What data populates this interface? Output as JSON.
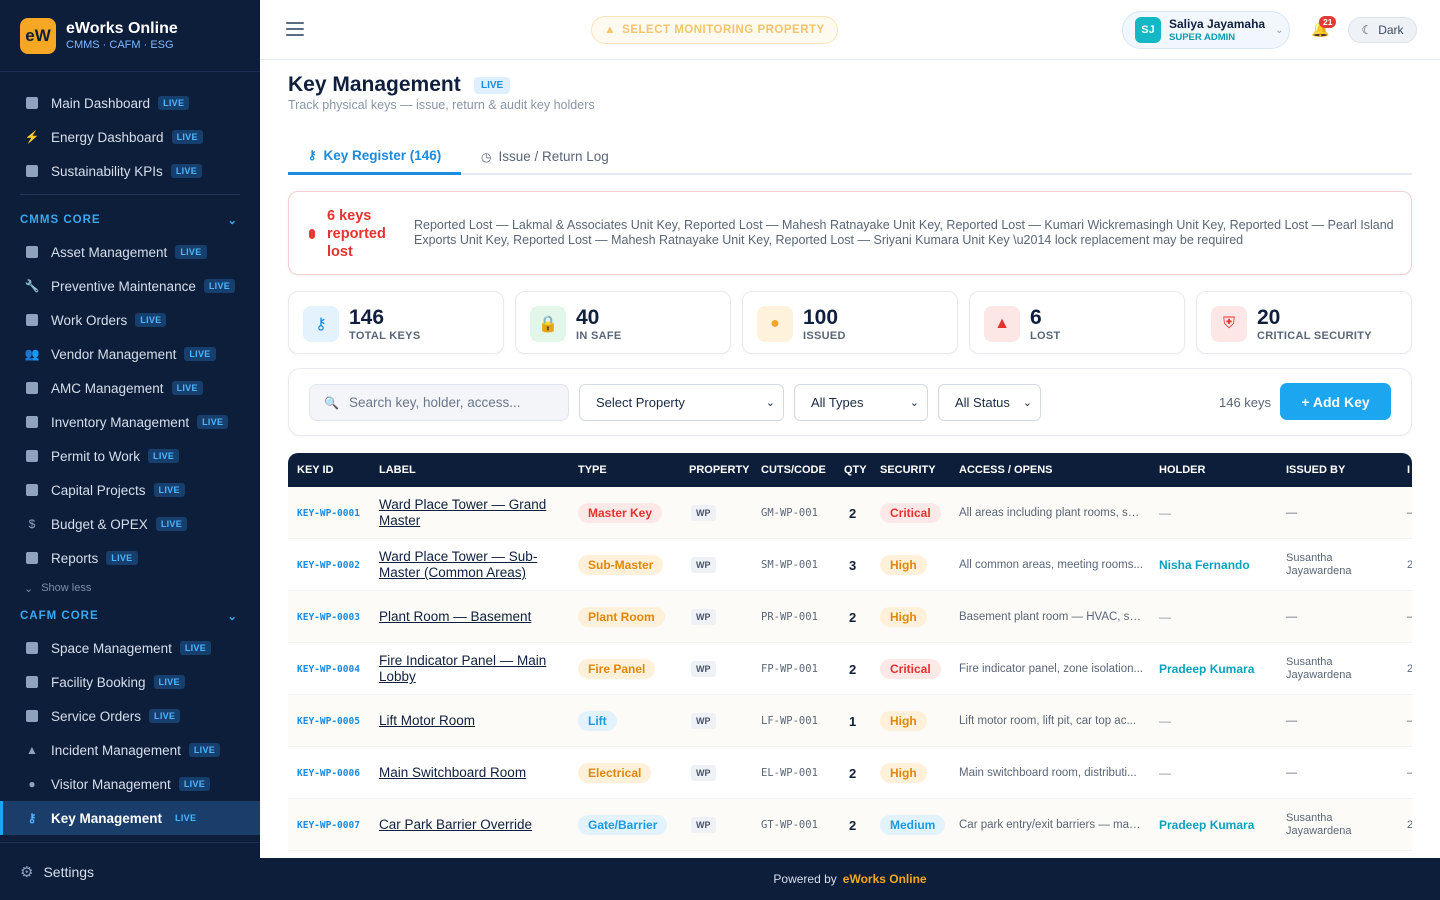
{
  "brand": {
    "logo": "eW",
    "name": "eWorks Online",
    "sub": "CMMS · CAFM · ESG"
  },
  "sidebar": {
    "top": [
      {
        "label": "Main Dashboard",
        "badge": "LIVE",
        "icon": "dashboard-icon"
      },
      {
        "label": "Energy Dashboard",
        "badge": "LIVE",
        "icon": "bolt-icon"
      },
      {
        "label": "Sustainability KPIs",
        "badge": "LIVE",
        "icon": "leaf-icon"
      }
    ],
    "cmms_title": "CMMS CORE",
    "cmms": [
      {
        "label": "Asset Management",
        "badge": "LIVE"
      },
      {
        "label": "Preventive Maintenance",
        "badge": "LIVE"
      },
      {
        "label": "Work Orders",
        "badge": "LIVE"
      },
      {
        "label": "Vendor Management",
        "badge": "LIVE"
      },
      {
        "label": "AMC Management",
        "badge": "LIVE"
      },
      {
        "label": "Inventory Management",
        "badge": "LIVE"
      },
      {
        "label": "Permit to Work",
        "badge": "LIVE"
      },
      {
        "label": "Capital Projects",
        "badge": "LIVE"
      },
      {
        "label": "Budget & OPEX",
        "badge": "LIVE"
      },
      {
        "label": "Reports",
        "badge": "LIVE"
      }
    ],
    "show_less": "Show less",
    "cafm_title": "CAFM CORE",
    "cafm": [
      {
        "label": "Space Management",
        "badge": "LIVE"
      },
      {
        "label": "Facility Booking",
        "badge": "LIVE"
      },
      {
        "label": "Service Orders",
        "badge": "LIVE"
      },
      {
        "label": "Incident Management",
        "badge": "LIVE"
      },
      {
        "label": "Visitor Management",
        "badge": "LIVE"
      },
      {
        "label": "Key Management",
        "badge": "LIVE"
      }
    ],
    "settings": "Settings"
  },
  "topbar": {
    "select_property": "SELECT MONITORING PROPERTY",
    "user": {
      "initials": "SJ",
      "name": "Saliya Jayamaha",
      "role": "SUPER ADMIN"
    },
    "notifications": "21",
    "theme_toggle": "Dark"
  },
  "page": {
    "title": "Key Management",
    "live": "LIVE",
    "subtitle": "Track physical keys — issue, return & audit key holders",
    "tabs": [
      {
        "label": "Key Register (146)"
      },
      {
        "label": "Issue / Return Log"
      }
    ]
  },
  "alert": {
    "headline": "6 keys reported lost",
    "text": "Reported Lost — Lakmal & Associates Unit Key, Reported Lost — Mahesh Ratnayake Unit Key, Reported Lost — Kumari Wickremasingh Unit Key, Reported Lost — Pearl Island Exports Unit Key, Reported Lost — Mahesh Ratnayake Unit Key, Reported Lost — Sriyani Kumara Unit Key \\u2014 lock replacement may be required"
  },
  "stats": [
    {
      "value": "146",
      "label": "TOTAL KEYS",
      "color": "#1b8be0",
      "bg": "#e3f2fd"
    },
    {
      "value": "40",
      "label": "IN SAFE",
      "color": "#1faa5b",
      "bg": "#e2f6ea"
    },
    {
      "value": "100",
      "label": "ISSUED",
      "color": "#f5a623",
      "bg": "#fff2dc"
    },
    {
      "value": "6",
      "label": "LOST",
      "color": "#e5322f",
      "bg": "#fde6e6"
    },
    {
      "value": "20",
      "label": "CRITICAL SECURITY",
      "color": "#e5322f",
      "bg": "#fde6e6"
    }
  ],
  "filters": {
    "search_placeholder": "Search key, holder, access...",
    "property": "Select Property",
    "types": "All Types",
    "status": "All Status",
    "count": "146 keys",
    "add_button": "+ Add Key"
  },
  "table": {
    "headers": [
      "KEY ID",
      "LABEL",
      "TYPE",
      "PROPERTY",
      "CUTS/CODE",
      "QTY",
      "SECURITY",
      "ACCESS / OPENS",
      "HOLDER",
      "ISSUED BY",
      "I"
    ],
    "rows": [
      {
        "id": "KEY-WP-0001",
        "label": "Ward Place Tower — Grand Master",
        "type": "Master Key",
        "type_color": "#e5322f",
        "type_bg": "#fde8e8",
        "property": "WP",
        "code": "GM-WP-001",
        "qty": "2",
        "security": "Critical",
        "sec_color": "#e5322f",
        "sec_bg": "#fde8e8",
        "access": "All areas including plant rooms, sw...",
        "holder": "—",
        "issued_by": "—",
        "extra": "–"
      },
      {
        "id": "KEY-WP-0002",
        "label": "Ward Place Tower — Sub-Master (Common Areas)",
        "type": "Sub-Master",
        "type_color": "#e0870a",
        "type_bg": "#fff1d9",
        "property": "WP",
        "code": "SM-WP-001",
        "qty": "3",
        "security": "High",
        "sec_color": "#e0870a",
        "sec_bg": "#fff1d9",
        "access": "All common areas, meeting rooms...",
        "holder": "Nisha Fernando",
        "issued_by": "Susantha Jayawardena",
        "extra": "2"
      },
      {
        "id": "KEY-WP-0003",
        "label": "Plant Room — Basement",
        "type": "Plant Room",
        "type_color": "#e0870a",
        "type_bg": "#fff1d9",
        "property": "WP",
        "code": "PR-WP-001",
        "qty": "2",
        "security": "High",
        "sec_color": "#e0870a",
        "sec_bg": "#fff1d9",
        "access": "Basement plant room — HVAC, sw...",
        "holder": "—",
        "issued_by": "—",
        "extra": "–"
      },
      {
        "id": "KEY-WP-0004",
        "label": "Fire Indicator Panel — Main Lobby",
        "type": "Fire Panel",
        "type_color": "#e0870a",
        "type_bg": "#fff1d9",
        "property": "WP",
        "code": "FP-WP-001",
        "qty": "2",
        "security": "Critical",
        "sec_color": "#e5322f",
        "sec_bg": "#fde8e8",
        "access": "Fire indicator panel, zone isolation...",
        "holder": "Pradeep Kumara",
        "issued_by": "Susantha Jayawardena",
        "extra": "2"
      },
      {
        "id": "KEY-WP-0005",
        "label": "Lift Motor Room",
        "type": "Lift",
        "type_color": "#1b9ae0",
        "type_bg": "#e2f3fd",
        "property": "WP",
        "code": "LF-WP-001",
        "qty": "1",
        "security": "High",
        "sec_color": "#e0870a",
        "sec_bg": "#fff1d9",
        "access": "Lift motor room, lift pit, car top ac...",
        "holder": "—",
        "issued_by": "—",
        "extra": "–"
      },
      {
        "id": "KEY-WP-0006",
        "label": "Main Switchboard Room",
        "type": "Electrical",
        "type_color": "#e0870a",
        "type_bg": "#fff1d9",
        "property": "WP",
        "code": "EL-WP-001",
        "qty": "2",
        "security": "High",
        "sec_color": "#e0870a",
        "sec_bg": "#fff1d9",
        "access": "Main switchboard room, distributi...",
        "holder": "—",
        "issued_by": "—",
        "extra": "–"
      },
      {
        "id": "KEY-WP-0007",
        "label": "Car Park Barrier Override",
        "type": "Gate/Barrier",
        "type_color": "#1b9ae0",
        "type_bg": "#e2f3fd",
        "property": "WP",
        "code": "GT-WP-001",
        "qty": "2",
        "security": "Medium",
        "sec_color": "#1b9ae0",
        "sec_bg": "#e2f3fd",
        "access": "Car park entry/exit barriers — man...",
        "holder": "Pradeep Kumara",
        "issued_by": "Susantha Jayawardena",
        "extra": "2"
      }
    ]
  },
  "footer": {
    "powered": "Powered by",
    "brand": "eWorks Online"
  }
}
